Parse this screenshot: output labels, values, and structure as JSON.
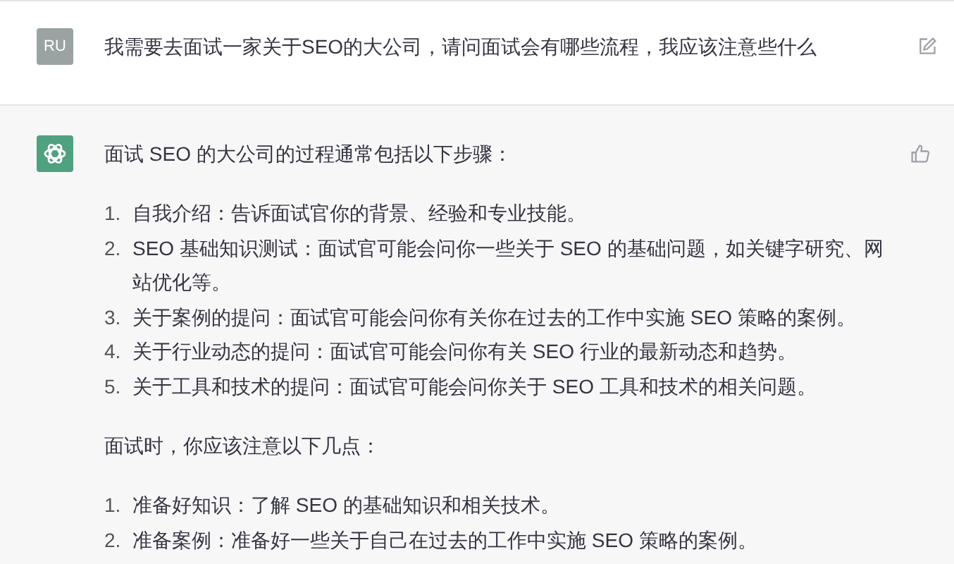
{
  "user_message": {
    "avatar": "RU",
    "text": "我需要去面试一家关于SEO的大公司，请问面试会有哪些流程，我应该注意些什么"
  },
  "assistant_message": {
    "intro": "面试 SEO 的大公司的过程通常包括以下步骤：",
    "steps": [
      {
        "number": "1.",
        "text": "自我介绍：告诉面试官你的背景、经验和专业技能。"
      },
      {
        "number": "2.",
        "text": "SEO 基础知识测试：面试官可能会问你一些关于 SEO 的基础问题，如关键字研究、网站优化等。"
      },
      {
        "number": "3.",
        "text": "关于案例的提问：面试官可能会问你有关你在过去的工作中实施 SEO 策略的案例。"
      },
      {
        "number": "4.",
        "text": "关于行业动态的提问：面试官可能会问你有关 SEO 行业的最新动态和趋势。"
      },
      {
        "number": "5.",
        "text": "关于工具和技术的提问：面试官可能会问你关于 SEO 工具和技术的相关问题。"
      }
    ],
    "tips_intro": "面试时，你应该注意以下几点：",
    "tips": [
      {
        "number": "1.",
        "text": "准备好知识：了解 SEO 的基础知识和相关技术。"
      },
      {
        "number": "2.",
        "text": "准备案例：准备好一些关于自己在过去的工作中实施 SEO 策略的案例。"
      }
    ]
  }
}
